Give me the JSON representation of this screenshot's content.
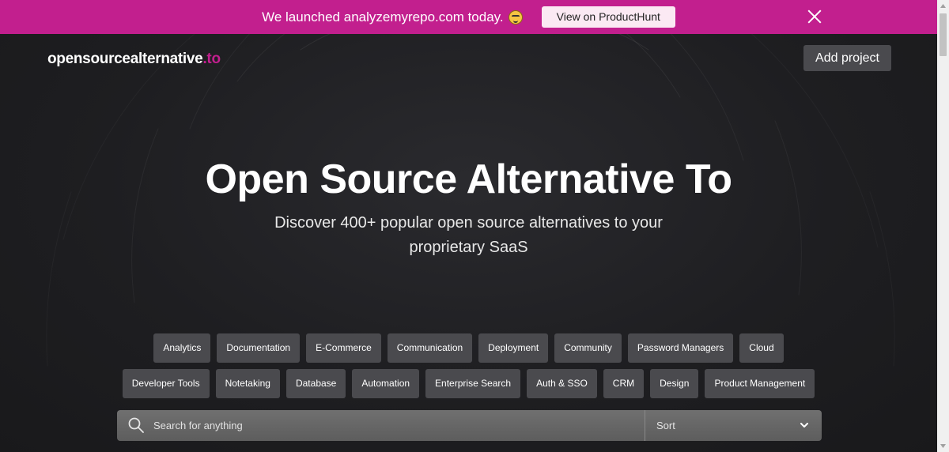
{
  "banner": {
    "text": "We launched analyzemyrepo.com today.",
    "emoji": "grinning-face-with-sweat-icon",
    "button_label": "View on ProductHunt",
    "close_icon": "close-icon",
    "background": "#c21f8e"
  },
  "header": {
    "logo_main": "opensourcealternative",
    "logo_tld": ".to",
    "add_project_label": "Add project"
  },
  "hero": {
    "title": "Open Source Alternative To",
    "subtitle_line1": "Discover 400+ popular open source alternatives to your",
    "subtitle_line2": "proprietary SaaS"
  },
  "categories": {
    "row1": [
      "Analytics",
      "Documentation",
      "E-Commerce",
      "Communication",
      "Deployment",
      "Community",
      "Password Managers",
      "Cloud"
    ],
    "row2": [
      "Developer Tools",
      "Notetaking",
      "Database",
      "Automation",
      "Enterprise Search",
      "Auth & SSO",
      "CRM",
      "Design",
      "Product Management"
    ]
  },
  "search": {
    "placeholder": "Search for anything",
    "search_icon": "search-icon",
    "sort_label": "Sort",
    "sort_icon": "chevron-down-icon"
  },
  "colors": {
    "accent": "#c21f8e",
    "background": "#1c1c1f",
    "tag_background": "#4a4a4e"
  }
}
